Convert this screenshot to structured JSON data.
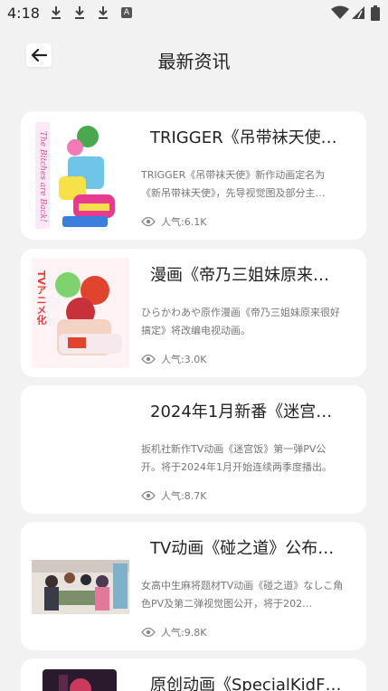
{
  "status_bar": {
    "time": "4:18",
    "image_badge": "A"
  },
  "header": {
    "title": "最新资讯"
  },
  "news": [
    {
      "title": "TRIGGER《吊带袜天使…",
      "summary": "TRIGGER《吊带袜天使》新作动画定名为《新吊带袜天使》，先导视觉图及部分主…",
      "views_label": "人气:6.1K",
      "thumb_text": "The Bitches are Back!!"
    },
    {
      "title": "漫画《帝乃三姐妹原来…",
      "summary": "ひらかわあや原作漫画《帝乃三姐妹原来很好搞定》将改编电视动画。",
      "views_label": "人气:3.0K",
      "thumb_text": "TVアニメ化"
    },
    {
      "title": "2024年1月新番《迷宫…",
      "summary": "扳机社新作TV动画《迷宫饭》第一弹PV公开。将于2024年1月开始连续两季度播出。",
      "views_label": "人气:8.7K"
    },
    {
      "title": "TV动画《碰之道》公布…",
      "summary": "女高中生麻将题材TV动画《碰之道》なしこ角色PV及第二弹视觉图公开，将于202…",
      "views_label": "人气:9.8K"
    },
    {
      "title": "原创动画《SpecialKidF…"
    }
  ]
}
